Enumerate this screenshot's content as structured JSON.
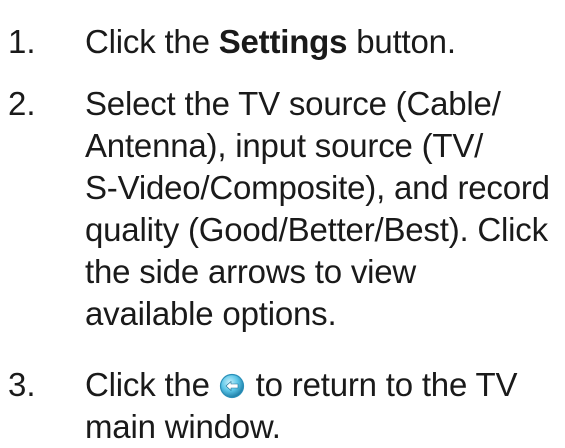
{
  "steps": [
    {
      "number": "1.",
      "text_before": "Click the ",
      "bold": "Settings",
      "text_after": " button."
    },
    {
      "number": "2.",
      "lines": [
        "Select the TV source (Cable/",
        "Antenna), input source (TV/",
        "S-Video/Composite), and record",
        "quality (Good/Better/Best). Click",
        "the side arrows to view",
        "available options."
      ]
    },
    {
      "number": "3.",
      "line1_before": "Click the ",
      "icon": "back-arrow-icon",
      "line1_after": " to return to the TV",
      "line2": "main window."
    }
  ],
  "colors": {
    "text": "#1a1a1a",
    "icon_fill": "#5bc6e8",
    "icon_border": "#2a8fb8"
  }
}
